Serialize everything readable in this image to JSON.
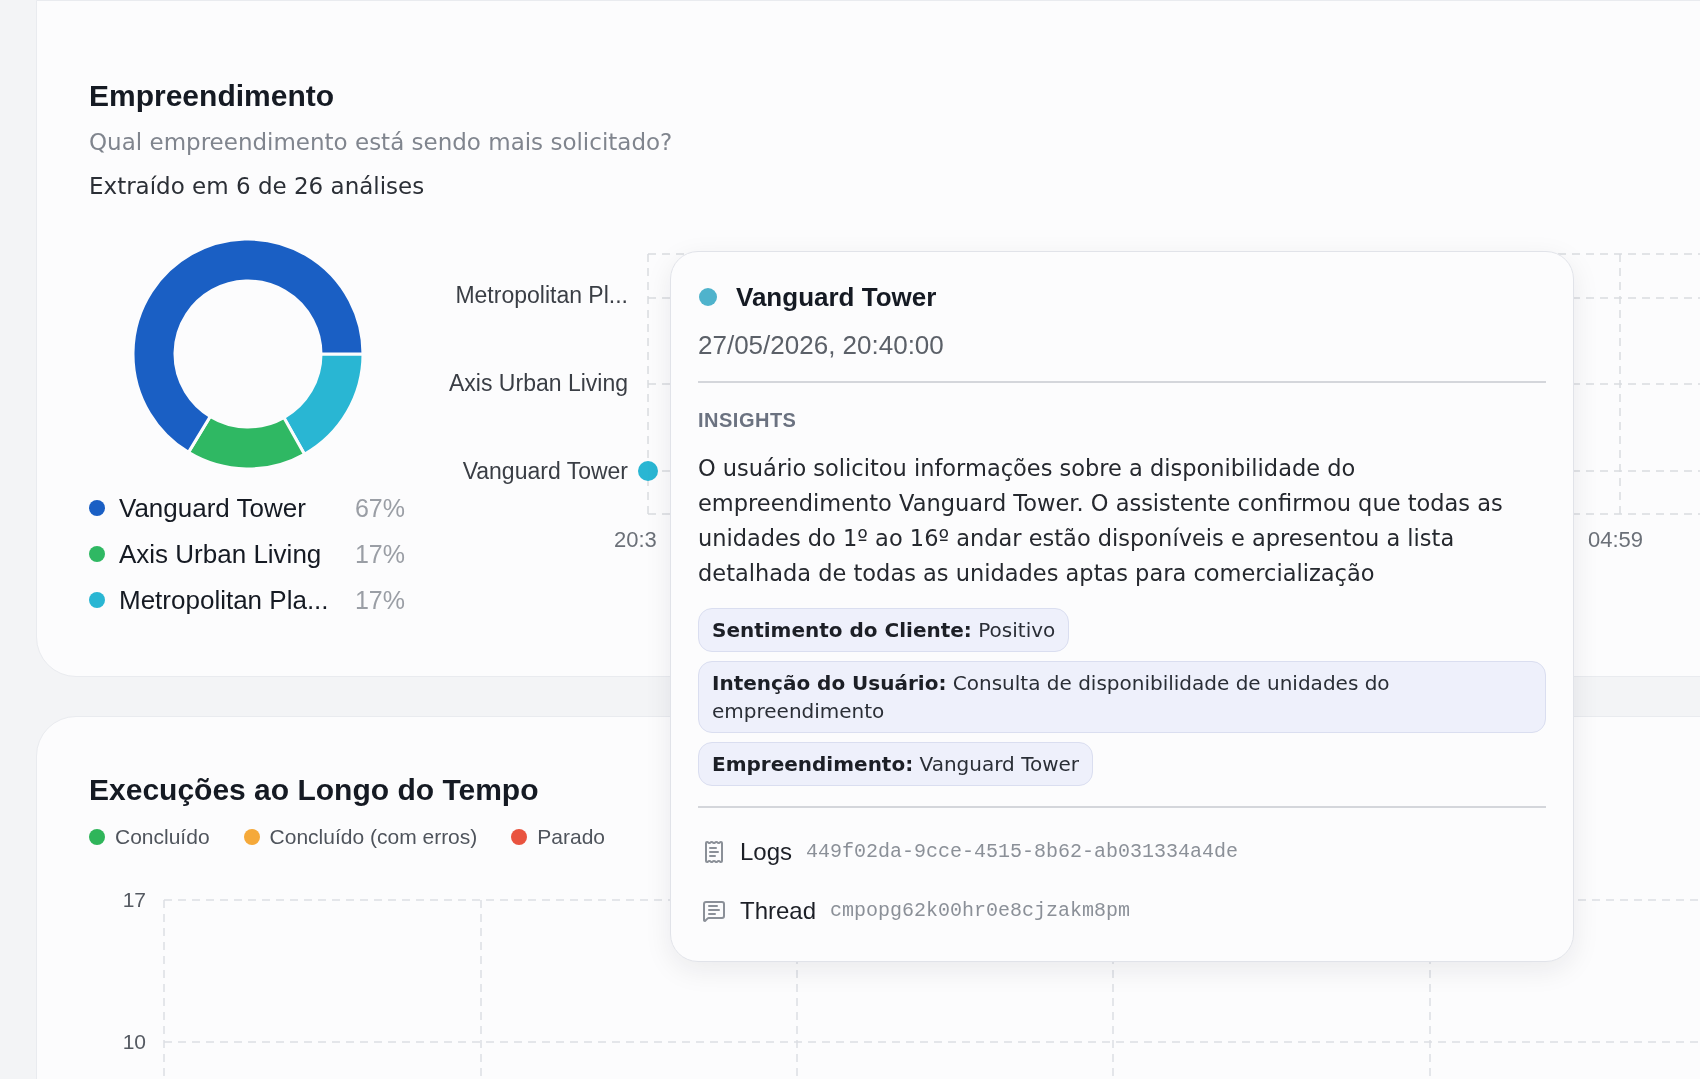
{
  "empreendimento_card": {
    "title": "Empreendimento",
    "question": "Qual empreendimento está sendo mais solicitado?",
    "extraction_note": "Extraído em 6 de 26 análises",
    "chart_data": {
      "type": "donut",
      "values": [
        67,
        17,
        17
      ]
    },
    "legend": [
      {
        "label": "Vanguard Tower",
        "percent": "67%",
        "color": "#1a5fc4"
      },
      {
        "label": "Axis Urban Living",
        "percent": "17%",
        "color": "#2fb863"
      },
      {
        "label": "Metropolitan Pla...",
        "percent": "17%",
        "color": "#29b6d3"
      }
    ],
    "timeline": {
      "rows": [
        {
          "label": "Metropolitan Pl...",
          "point_visible": false
        },
        {
          "label": "Axis Urban Living",
          "point_visible": false
        },
        {
          "label": "Vanguard Tower",
          "point_visible": true
        }
      ],
      "x_labels": [
        "20:3",
        "04:59"
      ]
    }
  },
  "tooltip": {
    "title": "Vanguard Tower",
    "timestamp": "27/05/2026, 20:40:00",
    "section_heading": "INSIGHTS",
    "summary": "O usuário solicitou informações sobre a disponibilidade do empreendimento Vanguard Tower. O assistente confirmou que todas as unidades do 1º ao 16º andar estão disponíveis e apresentou a lista detalhada de todas as unidades aptas para comercialização",
    "tags": [
      "**Sentimento do Cliente:** Positivo",
      "**Intenção do Usuário:** Consulta de disponibilidade de unidades do empreendimento",
      "**Empreendimento:** Vanguard Tower"
    ],
    "references": [
      {
        "kind": "logs",
        "label": "Logs",
        "value": "449f02da-9cce-4515-8b62-ab031334a4de"
      },
      {
        "kind": "thread",
        "label": "Thread",
        "value": "cmpopg62k00hr0e8cjzakm8pm"
      }
    ]
  },
  "executions_card": {
    "title": "Execuções ao Longo do Tempo",
    "legend": [
      {
        "label": "Concluído",
        "color": "#2fb55a"
      },
      {
        "label": "Concluído (com erros)",
        "color": "#f5a93a"
      },
      {
        "label": "Parado",
        "color": "#e9533f"
      }
    ],
    "y_labels": [
      "17",
      "10"
    ]
  }
}
